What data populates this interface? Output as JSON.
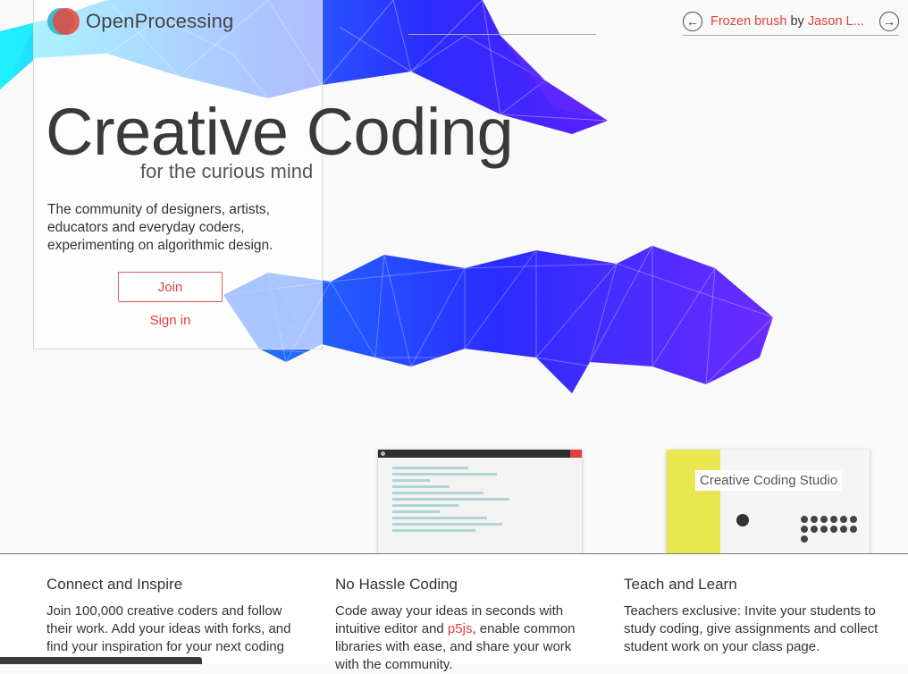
{
  "brand": {
    "name": "OpenProcessing"
  },
  "hero": {
    "title": "Creative Coding",
    "subtitle": "for the curious mind",
    "description": "The community of designers, artists, educators and everyday coders, experimenting on algorithmic design.",
    "join_label": "Join",
    "signin_label": "Sign in"
  },
  "featured_sketch": {
    "title": "Frozen brush",
    "by_label": "by",
    "author": "Jason L...",
    "prev_icon": "arrow-left-circle-icon",
    "next_icon": "arrow-right-circle-icon"
  },
  "preview": {
    "studio_title": "Creative Coding Studio"
  },
  "features": [
    {
      "title": "Connect and Inspire",
      "text": "Join 100,000 creative coders and follow their work. Add your ideas with forks, and find your inspiration for your next coding"
    },
    {
      "title": "No Hassle Coding",
      "text_before": "Code away your ideas in seconds with intuitive editor and ",
      "link": "p5js",
      "text_after": ", enable common libraries with ease, and share your work with the community."
    },
    {
      "title": "Teach and Learn",
      "text": "Teachers exclusive: Invite your students to study coding, give assignments and collect student work on your class page."
    }
  ],
  "colors": {
    "accent": "#e0413a",
    "art_blue": "#2a2cff",
    "art_violet": "#6a2bff",
    "art_cyan": "#1fe0ff"
  }
}
